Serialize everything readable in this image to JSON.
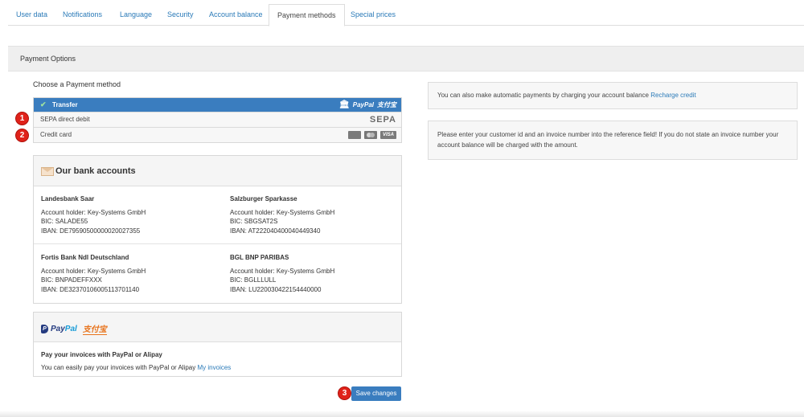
{
  "tabs": [
    {
      "label": "User data"
    },
    {
      "label": "Notifications"
    },
    {
      "label": "Language"
    },
    {
      "label": "Security"
    },
    {
      "label": "Account balance"
    },
    {
      "label": "Payment methods",
      "active": true
    },
    {
      "label": "Special prices"
    }
  ],
  "panel": {
    "title": "Payment Options"
  },
  "payment": {
    "choose_label": "Choose a Payment method",
    "methods": [
      {
        "label": "Transfer",
        "selected": true,
        "logos": [
          "bank-icon",
          "paypal-logo",
          "alipay-logo"
        ],
        "paypal_text": "PayPal",
        "alipay_text": "支付宝"
      },
      {
        "label": "SEPA direct debit",
        "logo_text": "SEPA"
      },
      {
        "label": "Credit card",
        "logos": [
          "amex-card-icon",
          "mastercard-icon",
          "visa-card-icon"
        ],
        "visa_text": "VISA"
      }
    ]
  },
  "steps": [
    "1",
    "2",
    "3"
  ],
  "bank_accounts": {
    "title": "Our bank accounts",
    "accounts": [
      {
        "name": "Landesbank Saar",
        "holder": "Account holder: Key-Systems GmbH",
        "bic": "BIC: SALADE55",
        "iban": "IBAN: DE79590500000020027355"
      },
      {
        "name": "Salzburger Sparkasse",
        "holder": "Account holder: Key-Systems GmbH",
        "bic": "BIC: SBGSAT2S",
        "iban": "IBAN: AT222040400040449340"
      },
      {
        "name": "Fortis Bank Ndl Deutschland",
        "holder": "Account holder: Key-Systems GmbH",
        "bic": "BIC: BNPADEFFXXX",
        "iban": "IBAN: DE32370106005113701140"
      },
      {
        "name": "BGL BNP PARIBAS",
        "holder": "Account holder: Key-Systems GmbH",
        "bic": "BIC: BGLLLULL",
        "iban": "IBAN: LU220030422154440000"
      }
    ]
  },
  "paypal_box": {
    "paypal_logo_text": "PayPal",
    "alipay_logo_text": "支付宝",
    "heading": "Pay your invoices with PayPal or Alipay",
    "text": "You can easily pay your invoices with PayPal or Alipay",
    "link": "My invoices"
  },
  "save_button": "Save changes",
  "info": {
    "recharge_text": "You can also make automatic payments by charging your account balance",
    "recharge_link": "Recharge credit",
    "reference_text": "Please enter your customer id and an invoice number into the reference field! If you do not state an invoice number your account balance will be charged with the amount."
  },
  "colors": {
    "accent": "#3a7dbf",
    "link": "#2a7ab8",
    "step_marker": "#e0221a"
  }
}
